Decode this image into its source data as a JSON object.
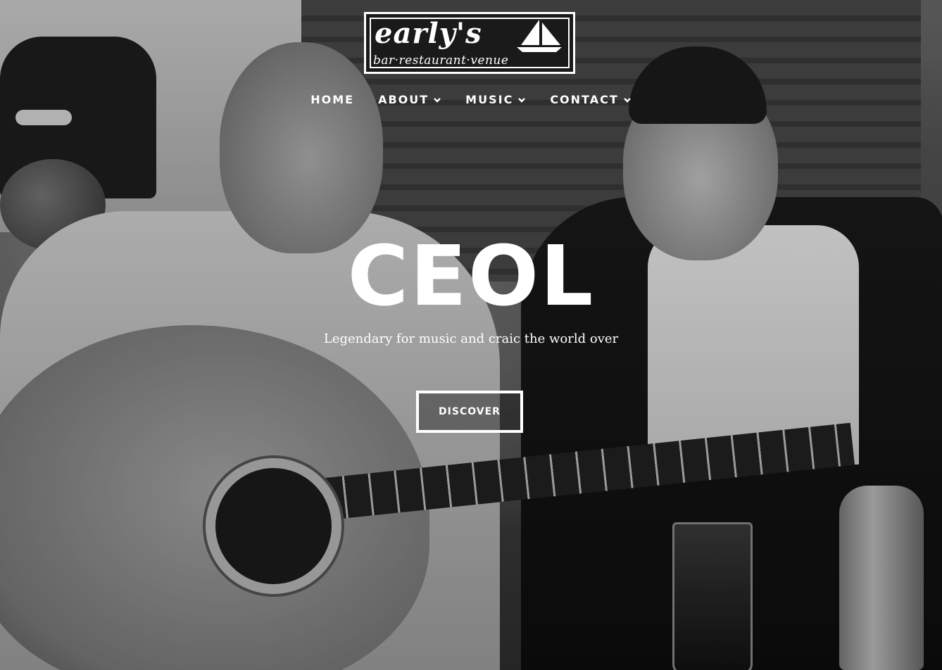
{
  "logo": {
    "name": "early's",
    "tagline": "bar·restaurant·venue",
    "icon": "sailboat-icon"
  },
  "nav": {
    "items": [
      {
        "label": "HOME",
        "has_dropdown": false
      },
      {
        "label": "ABOUT",
        "has_dropdown": true
      },
      {
        "label": "MUSIC",
        "has_dropdown": true
      },
      {
        "label": "CONTACT",
        "has_dropdown": true
      }
    ],
    "dropdown_icon": "chevron-down-icon"
  },
  "hero": {
    "title": "CEOL",
    "subtitle": "Legendary for music and craic the world over",
    "cta_label": "DISCOVER"
  },
  "colors": {
    "text": "#ffffff",
    "logo_bg": "#1a1a1a"
  }
}
